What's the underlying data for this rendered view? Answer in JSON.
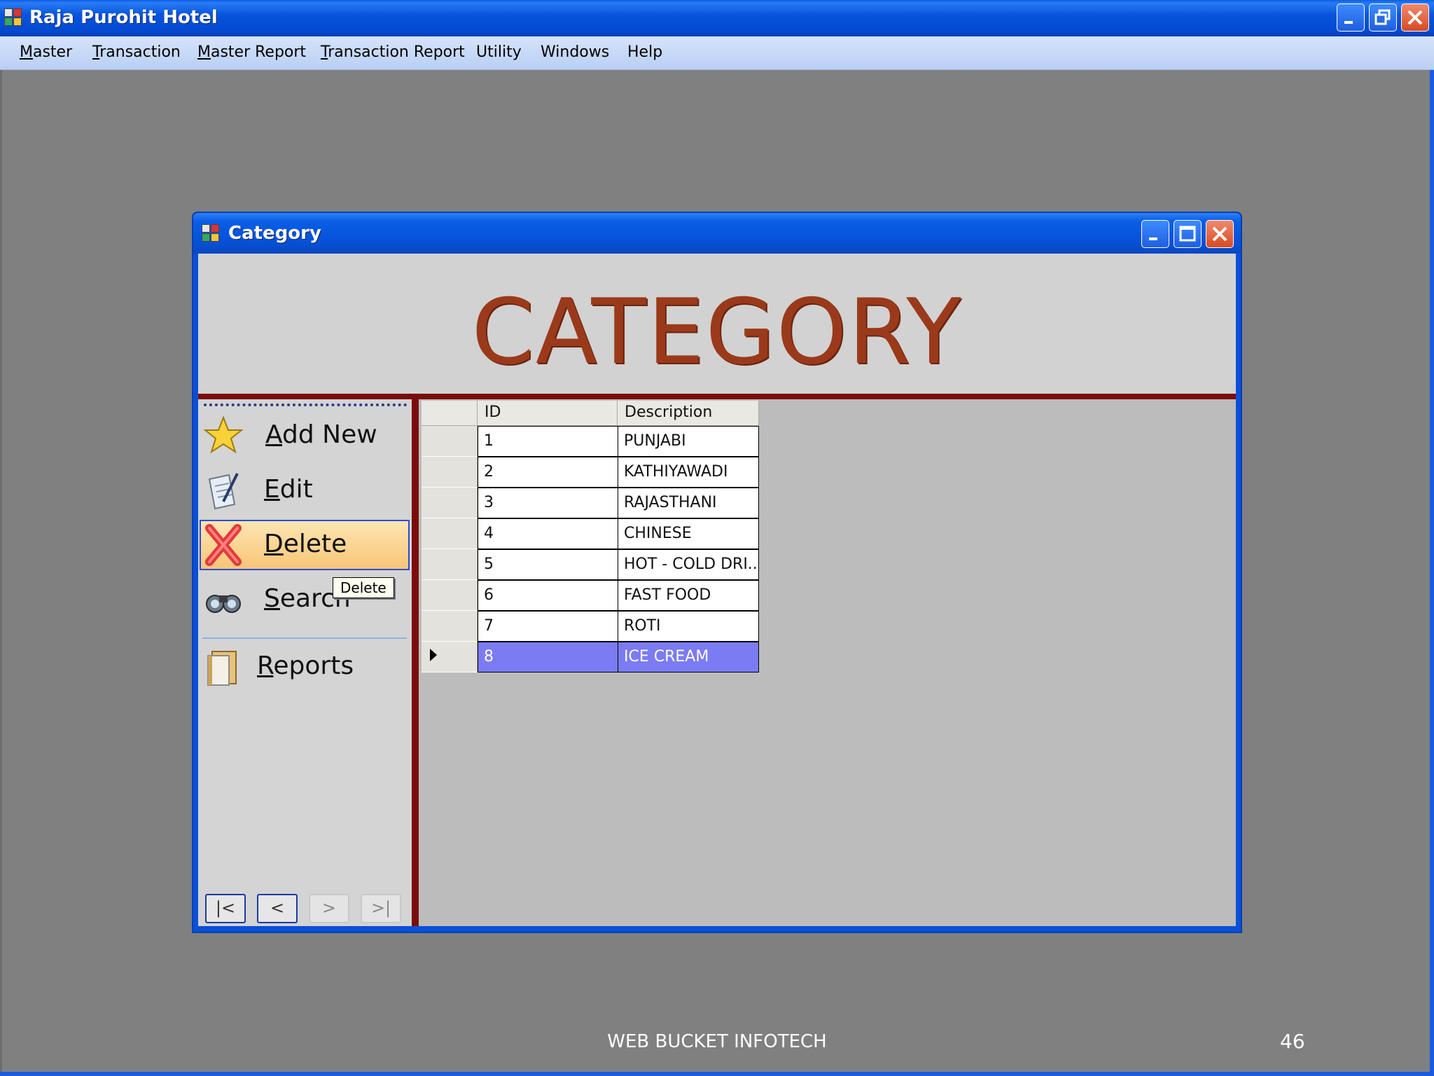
{
  "app": {
    "title": "Raja Purohit Hotel"
  },
  "menubar": {
    "items": [
      {
        "mnemonic": "M",
        "rest": "aster"
      },
      {
        "mnemonic": "T",
        "rest": "ransaction"
      },
      {
        "mnemonic": "M",
        "rest": "aster Report"
      },
      {
        "mnemonic": "T",
        "rest": "ransaction Report"
      },
      {
        "mnemonic": "",
        "rest": "Utility"
      },
      {
        "mnemonic": "",
        "rest": "Windows"
      },
      {
        "mnemonic": "",
        "rest": "Help"
      }
    ]
  },
  "child_window": {
    "title": "Category",
    "banner": "CATEGORY"
  },
  "toolbar": {
    "add_new": {
      "mnemonic": "A",
      "rest": "dd New"
    },
    "edit": {
      "mnemonic": "E",
      "rest": "dit"
    },
    "delete": {
      "mnemonic": "D",
      "rest": "elete"
    },
    "search": {
      "mnemonic": "S",
      "rest": "earch"
    },
    "reports": {
      "mnemonic": "R",
      "rest": "eports"
    },
    "tooltip": "Delete"
  },
  "navigation": {
    "first": "|<",
    "prev": "<",
    "next": ">",
    "last": ">|"
  },
  "grid": {
    "columns": [
      "ID",
      "Description"
    ],
    "rows": [
      [
        "1",
        "PUNJABI"
      ],
      [
        "2",
        "KATHIYAWADI"
      ],
      [
        "3",
        "RAJASTHANI"
      ],
      [
        "4",
        "CHINESE"
      ],
      [
        "5",
        "HOT - COLD DRI..."
      ],
      [
        "6",
        "FAST FOOD"
      ],
      [
        "7",
        "ROTI"
      ],
      [
        "8",
        "ICE CREAM"
      ]
    ],
    "selected_row": 8
  },
  "footer": {
    "company": "WEB BUCKET INFOTECH",
    "page": "46"
  },
  "colors": {
    "titlebar": "#0855dd",
    "banner_text": "#9a3a1a",
    "accent_border": "#7a0c0c",
    "selection": "#7b7bf3"
  }
}
